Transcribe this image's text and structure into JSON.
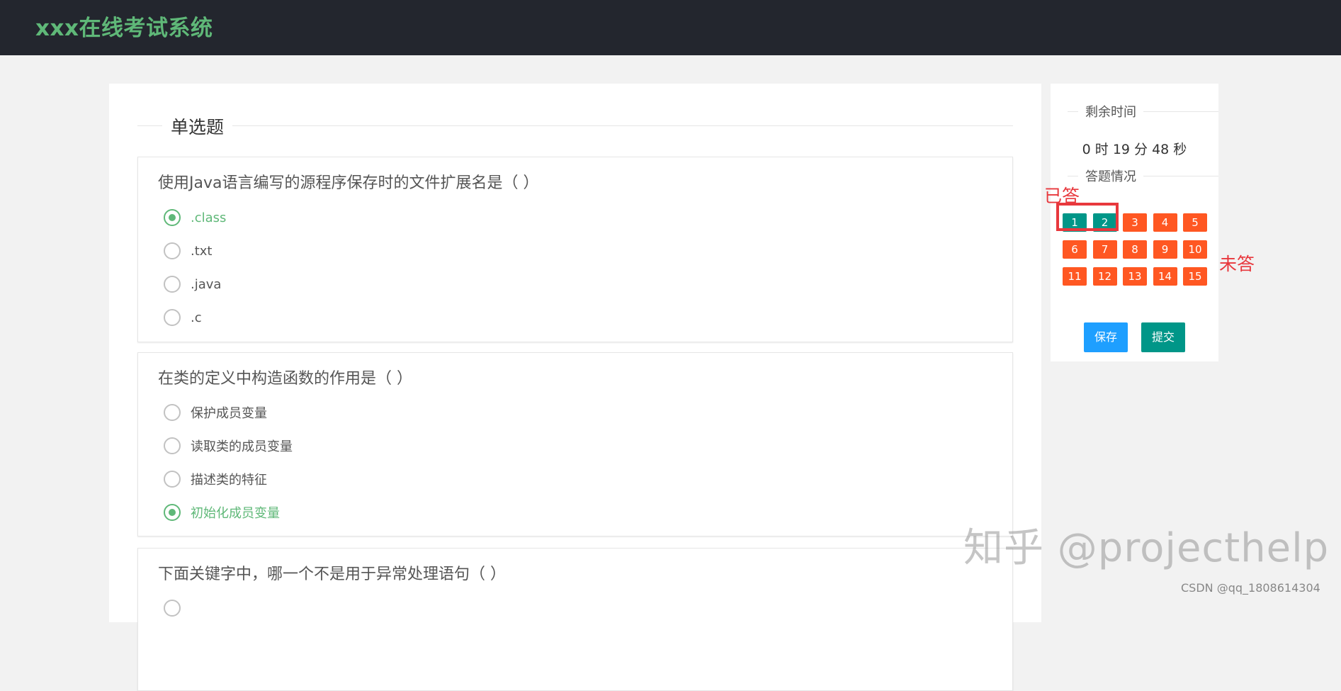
{
  "app": {
    "title": "xxx在线考试系统"
  },
  "section": {
    "title": "单选题"
  },
  "questions": [
    {
      "text": "使用Java语言编写的源程序保存时的文件扩展名是（ ）",
      "options": [
        {
          "label": ".class",
          "checked": true
        },
        {
          "label": ".txt",
          "checked": false
        },
        {
          "label": ".java",
          "checked": false
        },
        {
          "label": ".c",
          "checked": false
        }
      ]
    },
    {
      "text": "在类的定义中构造函数的作用是（ ）",
      "options": [
        {
          "label": "保护成员变量",
          "checked": false
        },
        {
          "label": "读取类的成员变量",
          "checked": false
        },
        {
          "label": "描述类的特征",
          "checked": false
        },
        {
          "label": "初始化成员变量",
          "checked": true
        }
      ]
    },
    {
      "text": "下面关键字中，哪一个不是用于异常处理语句（ ）",
      "options": []
    }
  ],
  "sidebar": {
    "remaining_time_label": "剩余时间",
    "timer": "0 时 19 分 48 秒",
    "progress_label": "答题情况",
    "numbers": [
      "1",
      "2",
      "3",
      "4",
      "5",
      "6",
      "7",
      "8",
      "9",
      "10",
      "11",
      "12",
      "13",
      "14",
      "15"
    ],
    "answered": [
      "1",
      "2"
    ],
    "save_label": "保存",
    "submit_label": "提交"
  },
  "annotations": {
    "answered": "已答",
    "unanswered": "未答"
  },
  "watermark": "知乎 @projecthelp",
  "credit": "CSDN @qq_1808614304",
  "colors": {
    "header_bg": "#23262e",
    "brand_green": "#5fb878",
    "answered": "#009688",
    "unanswered": "#ff5722",
    "save_button": "#1e9fff",
    "submit_button": "#009688",
    "annotation_red": "#e8383d"
  }
}
